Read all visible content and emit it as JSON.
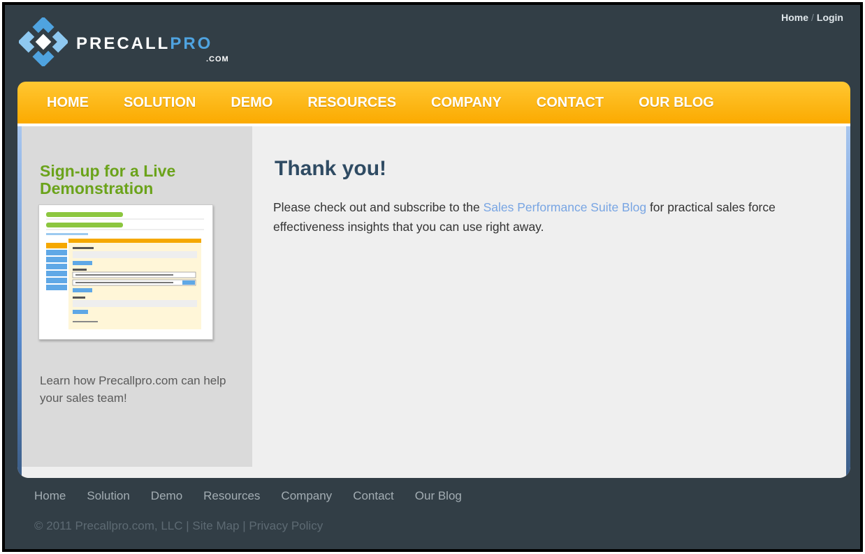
{
  "header": {
    "logo": {
      "brand_main": "PRECALL",
      "brand_accent": "PRO",
      "brand_sub": ".COM"
    },
    "top_links": {
      "home": "Home",
      "separator": "/",
      "login": "Login"
    }
  },
  "nav": {
    "items": [
      "HOME",
      "SOLUTION",
      "DEMO",
      "RESOURCES",
      "COMPANY",
      "CONTACT",
      "OUR BLOG"
    ]
  },
  "sidebar": {
    "title": "Sign-up for a Live Demonstration",
    "text": "Learn how Precallpro.com can help your sales team!"
  },
  "main": {
    "title": "Thank you!",
    "text_before": "Please check out and subscribe to the ",
    "link_text": "Sales Performance Suite Blog",
    "text_after": " for practical sales force effectiveness insights that you can use right away."
  },
  "footer": {
    "nav": [
      "Home",
      "Solution",
      "Demo",
      "Resources",
      "Company",
      "Contact",
      "Our Blog"
    ],
    "copyright": "© 2011 Precallpro.com, LLC",
    "divider": " | ",
    "site_map": "Site Map",
    "privacy": "Privacy Policy"
  },
  "colors": {
    "background": "#323e46",
    "nav_orange": "#fbaa00",
    "sidebar_green": "#6ba31b",
    "link_blue": "#78a5e3",
    "title_blue": "#2f4b63"
  }
}
